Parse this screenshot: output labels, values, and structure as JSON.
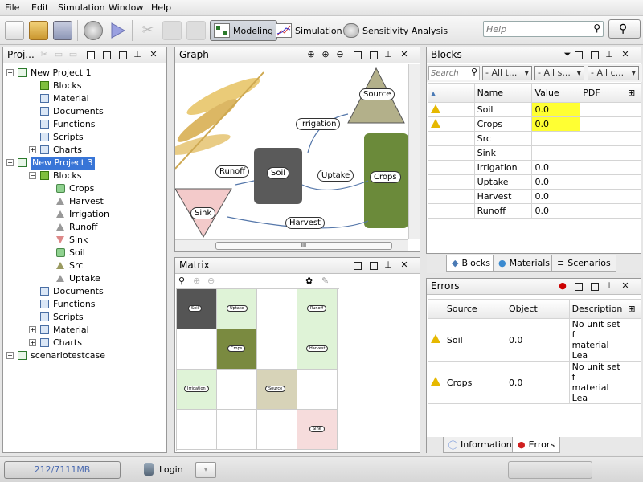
{
  "menu": [
    "File",
    "Edit",
    "Simulation",
    "Window",
    "Help"
  ],
  "toolbar": {
    "perspectives": [
      {
        "label": "Modeling"
      },
      {
        "label": "Simulation"
      },
      {
        "label": "Sensitivity Analysis"
      }
    ],
    "help_placeholder": "Help"
  },
  "project_panel": {
    "title": "Proj...",
    "tree": [
      {
        "label": "New Project 1"
      },
      {
        "label": "Blocks"
      },
      {
        "label": "Material"
      },
      {
        "label": "Documents"
      },
      {
        "label": "Functions"
      },
      {
        "label": "Scripts"
      },
      {
        "label": "Charts"
      },
      {
        "label": "New Project 3"
      },
      {
        "label": "Blocks"
      },
      {
        "label": "Crops"
      },
      {
        "label": "Harvest"
      },
      {
        "label": "Irrigation"
      },
      {
        "label": "Runoff"
      },
      {
        "label": "Sink"
      },
      {
        "label": "Soil"
      },
      {
        "label": "Src"
      },
      {
        "label": "Uptake"
      },
      {
        "label": "Documents"
      },
      {
        "label": "Functions"
      },
      {
        "label": "Scripts"
      },
      {
        "label": "Material"
      },
      {
        "label": "Charts"
      },
      {
        "label": "scenariotestcase"
      }
    ]
  },
  "graph_panel": {
    "title": "Graph",
    "nodes": {
      "source": "Source",
      "irrigation": "Irrigation",
      "runoff": "Runoff",
      "soil": "Soil",
      "uptake": "Uptake",
      "crops": "Crops",
      "sink": "Sink",
      "harvest": "Harvest"
    },
    "scroll_mark": "III"
  },
  "matrix_panel": {
    "title": "Matrix",
    "cells": {
      "soil": "Soil",
      "uptake": "Uptake",
      "runoff": "Runoff",
      "crops": "Crops",
      "harvest": "Harvest",
      "irrigation": "Irrigation",
      "source": "Source",
      "sink": "Sink"
    }
  },
  "blocks_panel": {
    "title": "Blocks",
    "search_placeholder": "Search",
    "filters": [
      "- All t...",
      "- All s...",
      "- All c..."
    ],
    "columns": [
      "Name",
      "Value",
      "PDF"
    ],
    "rows": [
      {
        "name": "Soil",
        "value": "0.0"
      },
      {
        "name": "Crops",
        "value": "0.0"
      },
      {
        "name": "Src",
        "value": ""
      },
      {
        "name": "Sink",
        "value": ""
      },
      {
        "name": "Irrigation",
        "value": "0.0"
      },
      {
        "name": "Uptake",
        "value": "0.0"
      },
      {
        "name": "Harvest",
        "value": "0.0"
      },
      {
        "name": "Runoff",
        "value": "0.0"
      }
    ],
    "tabs": [
      "Blocks",
      "Materials",
      "Scenarios"
    ]
  },
  "errors_panel": {
    "title": "Errors",
    "columns": [
      "Source",
      "Object",
      "Description"
    ],
    "rows": [
      {
        "source": "Soil",
        "object": "0.0",
        "desc1": "No unit set f",
        "desc2": "material Lea"
      },
      {
        "source": "Crops",
        "object": "0.0",
        "desc1": "No unit set f",
        "desc2": "material Lea"
      }
    ],
    "tabs": [
      "Information",
      "Errors"
    ]
  },
  "status": {
    "memory": "212/7111MB",
    "login": "Login"
  },
  "colors": {
    "selection": "#3875d7",
    "warning": "#e6b800",
    "highlight": "#ffff33"
  }
}
